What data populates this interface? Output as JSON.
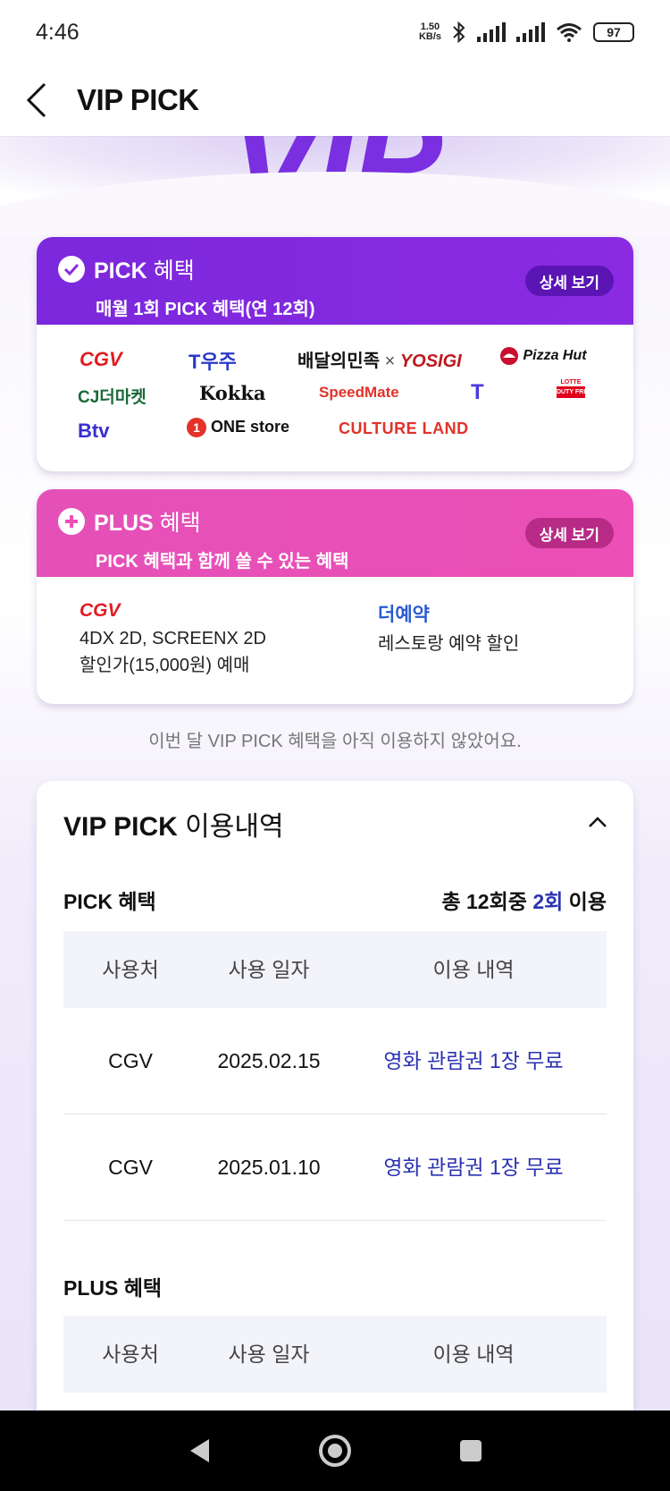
{
  "status_bar": {
    "time": "4:46",
    "net_speed_value": "1.50",
    "net_speed_unit": "KB/s",
    "battery": "97"
  },
  "header": {
    "title": "VIP PICK"
  },
  "hero": {
    "text": "VIP"
  },
  "pick_card": {
    "title_bold": "PICK",
    "title_rest": "혜택",
    "subtitle": "매월 1회 PICK 혜택(연 12회)",
    "detail_button": "상세 보기",
    "logos": {
      "cgv": "CGV",
      "tuju": "T우주",
      "baemin": "배달의민족",
      "times": "×",
      "yosigi": "YOSIGI",
      "pizzahut": "Pizza Hut",
      "cjthemarket": "CJ더마켓",
      "kokka": "Kokka",
      "speedmate": "SpeedMate",
      "t_logo": "T",
      "lotte_top": "LOTTE",
      "lotte_bottom": "DUTY FREE",
      "btv": "Btv",
      "onestore_num": "1",
      "onestore": "ONE store",
      "cultureland": "CULTURE LAND"
    }
  },
  "plus_card": {
    "title_bold": "PLUS",
    "title_rest": "혜택",
    "subtitle": "PICK 혜택과 함께 쓸 수 있는 혜택",
    "detail_button": "상세 보기",
    "left_logo": "CGV",
    "left_line1": "4DX 2D, SCREENX 2D",
    "left_line2": "할인가(15,000원) 예매",
    "right_logo": "더예약",
    "right_line1": "레스토랑 예약 할인"
  },
  "notice": "이번 달 VIP PICK 혜택을 아직 이용하지 않았어요.",
  "history": {
    "title_bold": "VIP PICK",
    "title_rest": "이용내역",
    "pick_section": {
      "label": "PICK 혜택",
      "usage_prefix": "총 12회중",
      "usage_count": "2회",
      "usage_suffix": "이용",
      "columns": [
        "사용처",
        "사용 일자",
        "이용 내역"
      ],
      "rows": [
        {
          "place": "CGV",
          "date": "2025.02.15",
          "detail": "영화 관람권 1장 무료"
        },
        {
          "place": "CGV",
          "date": "2025.01.10",
          "detail": "영화 관람권 1장 무료"
        }
      ]
    },
    "plus_section": {
      "label": "PLUS 혜택",
      "columns": [
        "사용처",
        "사용 일자",
        "이용 내역"
      ]
    }
  },
  "colors": {
    "pick_purple": "#8a2be2",
    "plus_pink": "#ec4fb6",
    "accent_blue": "#2b32b2"
  }
}
